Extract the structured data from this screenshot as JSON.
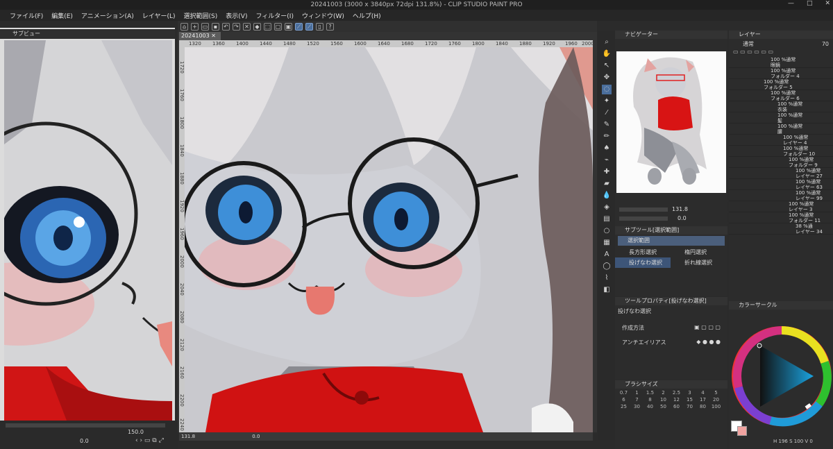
{
  "window": {
    "title": "20241003 (3000 x 3840px 72dpi 131.8%) - CLIP STUDIO PAINT PRO",
    "controls": [
      "—",
      "□",
      "✕"
    ]
  },
  "menu": [
    "ファイル(F)",
    "編集(E)",
    "アニメーション(A)",
    "レイヤー(L)",
    "選択範囲(S)",
    "表示(V)",
    "フィルター(I)",
    "ウィンドウ(W)",
    "ヘルプ(H)"
  ],
  "subview": {
    "title": "サブビュー",
    "zoom": "150.0",
    "angle": "0.0"
  },
  "canvas": {
    "tab": "20241003",
    "ruler_labels": [
      "1320",
      "1360",
      "1400",
      "1440",
      "1480",
      "1520",
      "1560",
      "1600",
      "1640",
      "1680",
      "1720",
      "1760",
      "1800",
      "1840",
      "1880",
      "1920",
      "1960",
      "2000"
    ],
    "ruler_v_labels": [
      "1720",
      "1760",
      "1800",
      "1840",
      "1880",
      "1920",
      "1960",
      "2000",
      "2040",
      "2080",
      "2120",
      "2160",
      "2200",
      "2240"
    ],
    "zoom": "131.8",
    "angle": "0.0"
  },
  "navigator": {
    "title": "ナビゲーター",
    "zoom": "131.8",
    "angle": "0.0"
  },
  "subtool": {
    "title": "サブツール[選択範囲]",
    "group": "選択範囲",
    "items": [
      "長方形選択",
      "楕円選択",
      "投げなわ選択",
      "折れ線選択"
    ]
  },
  "toolprop": {
    "title": "ツールプロパティ[投げなわ選択]",
    "name": "投げなわ選択",
    "row1": "作成方法",
    "row2": "アンチエイリアス"
  },
  "brush": {
    "title": "ブラシサイズ",
    "sizes": [
      "0.7",
      "1",
      "1.5",
      "2",
      "2.5",
      "3",
      "4",
      "5",
      "6",
      "7",
      "8",
      "10",
      "12",
      "15",
      "17",
      "20",
      "25",
      "30",
      "40",
      "50",
      "60",
      "70",
      "80",
      "100"
    ]
  },
  "layers": {
    "title": "レイヤー",
    "blend": "通常",
    "opacity": "70",
    "rows": [
      {
        "l1": "100 %通常",
        "l2": "眼鏡"
      },
      {
        "l1": "100 %通常",
        "l2": "フォルダー 4"
      },
      {
        "l1": "100 %通常",
        "l2": "フォルダー 5"
      },
      {
        "l1": "100 %通常",
        "l2": "フォルダー 6"
      },
      {
        "l1": "100 %通常",
        "l2": "衣装"
      },
      {
        "l1": "100 %通常",
        "l2": "髪"
      },
      {
        "l1": "100 %通常",
        "l2": "腰"
      },
      {
        "l1": "100 %通常",
        "l2": "レイヤー 4"
      },
      {
        "l1": "100 %通常",
        "l2": "フォルダー 10"
      },
      {
        "l1": "100 %通常",
        "l2": "フォルダー 9"
      },
      {
        "l1": "100 %通常",
        "l2": "レイヤー 27"
      },
      {
        "l1": "100 %通常",
        "l2": "レイヤー 63"
      },
      {
        "l1": "100 %通常",
        "l2": "レイヤー 99"
      },
      {
        "l1": "100 %通常",
        "l2": "レイヤー 3"
      },
      {
        "l1": "100 %通常",
        "l2": "フォルダー 11"
      },
      {
        "l1": "38 %通",
        "l2": "レイヤー 34"
      }
    ]
  },
  "color": {
    "title": "カラーサークル",
    "h": "196",
    "s": "100",
    "v": "0",
    "fg": "#ffffff",
    "bg": "#f0a3a0"
  }
}
